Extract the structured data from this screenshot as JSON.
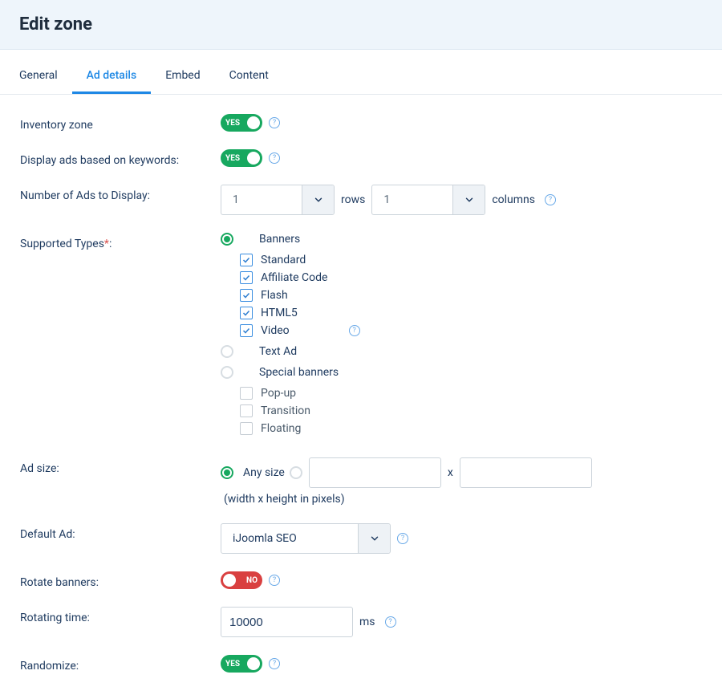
{
  "header": {
    "title": "Edit zone"
  },
  "tabs": [
    {
      "id": "general",
      "label": "General",
      "active": false
    },
    {
      "id": "ad-details",
      "label": "Ad details",
      "active": true
    },
    {
      "id": "embed",
      "label": "Embed",
      "active": false
    },
    {
      "id": "content",
      "label": "Content",
      "active": false
    }
  ],
  "toggleText": {
    "yes": "YES",
    "no": "NO"
  },
  "labels": {
    "inventory_zone": "Inventory zone",
    "display_keywords": "Display ads based on keywords:",
    "num_ads": "Number of Ads to Display:",
    "rows": "rows",
    "columns": "columns",
    "supported_types": "Supported Types",
    "ad_size": "Ad size:",
    "any_size": "Any size",
    "wh_hint": "(width x height in pixels)",
    "x": "x",
    "default_ad": "Default Ad:",
    "rotate_banners": "Rotate banners:",
    "rotating_time": "Rotating time:",
    "ms": "ms",
    "randomize": "Randomize:"
  },
  "values": {
    "inventory_zone": "YES",
    "display_keywords": "YES",
    "rows": "1",
    "columns": "1",
    "default_ad": "iJoomla SEO",
    "rotate_banners": "NO",
    "rotating_time": "10000",
    "randomize": "YES",
    "ad_size_mode": "any",
    "width": "",
    "height": ""
  },
  "supported_types": {
    "selected": "banners",
    "groups": [
      {
        "id": "banners",
        "label": "Banners",
        "enabled": true,
        "checked": true,
        "children": [
          {
            "id": "standard",
            "label": "Standard",
            "checked": true
          },
          {
            "id": "affiliate",
            "label": "Affiliate Code",
            "checked": true
          },
          {
            "id": "flash",
            "label": "Flash",
            "checked": true
          },
          {
            "id": "html5",
            "label": "HTML5",
            "checked": true
          },
          {
            "id": "video",
            "label": "Video",
            "checked": true,
            "help": true
          }
        ]
      },
      {
        "id": "text-ad",
        "label": "Text Ad",
        "enabled": false,
        "checked": false,
        "children": []
      },
      {
        "id": "special",
        "label": "Special banners",
        "enabled": false,
        "checked": false,
        "children": [
          {
            "id": "popup",
            "label": "Pop-up",
            "checked": false
          },
          {
            "id": "transition",
            "label": "Transition",
            "checked": false
          },
          {
            "id": "floating",
            "label": "Floating",
            "checked": false
          }
        ]
      }
    ]
  }
}
